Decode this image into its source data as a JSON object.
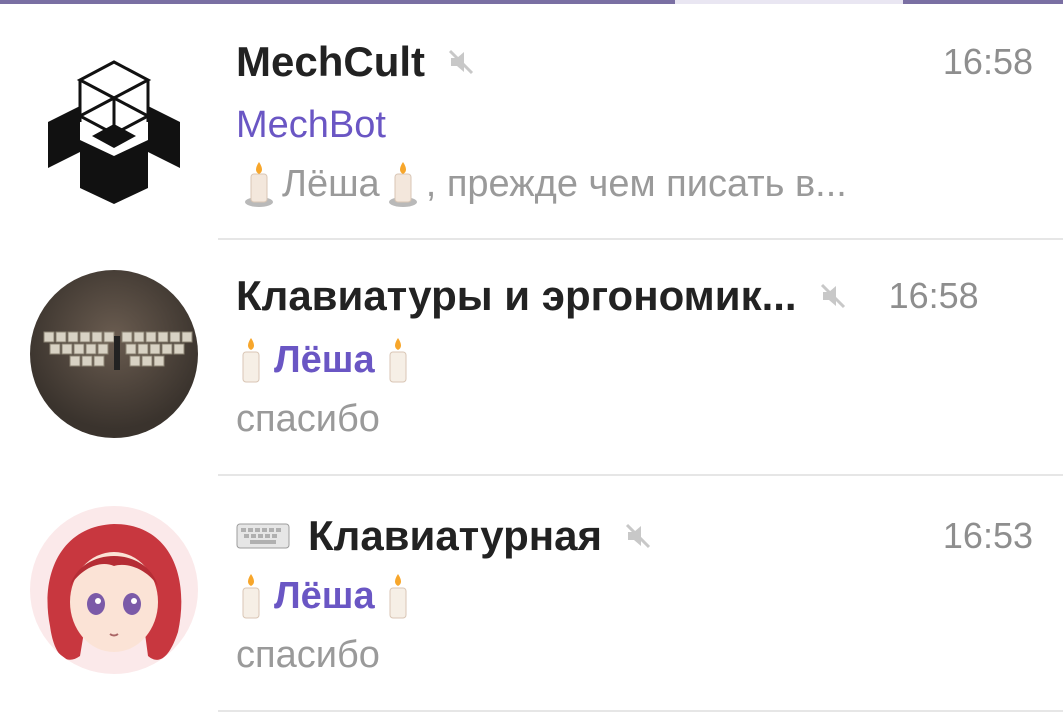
{
  "chats": [
    {
      "name": "MechCult",
      "time": "16:58",
      "sender": "MechBot",
      "preview_name": "Лёша",
      "preview_rest": ", прежде чем писать в...",
      "avatar_icon": "mechcult-logo-icon",
      "muted": true
    },
    {
      "name": "Клавиатуры и эргономик...",
      "time": "16:58",
      "sender": "Лёша",
      "preview": "спасибо",
      "avatar_icon": "split-keyboard-photo",
      "muted": true
    },
    {
      "name": "Клавиатурная",
      "time": "16:53",
      "sender": "Лёша",
      "preview": "спасибо",
      "avatar_icon": "anime-girl-avatar",
      "title_icon": "keyboard-emoji-icon",
      "muted": true
    }
  ],
  "colors": {
    "accent": "#6a56c4",
    "topbar": "#7a6fa3",
    "muted_text": "#9a9a9a",
    "time": "#8e8e8e"
  }
}
